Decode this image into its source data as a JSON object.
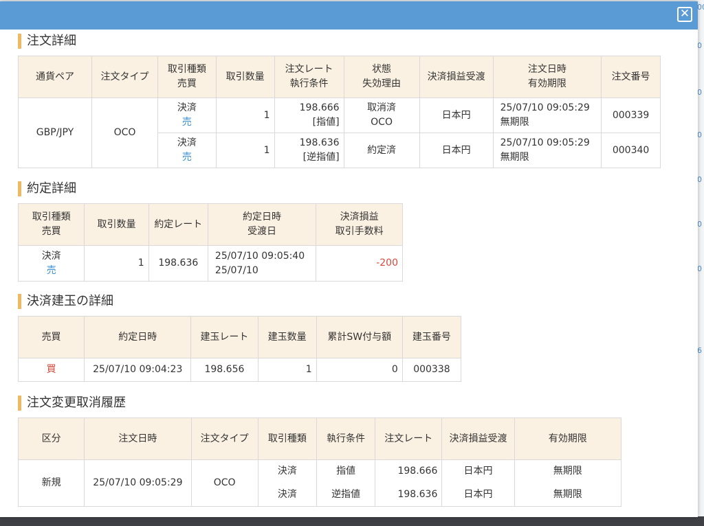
{
  "close_label": "✕",
  "background": {
    "side_values": [
      "00",
      "0",
      "0",
      "0",
      "0",
      "0",
      "0",
      "6"
    ]
  },
  "order_detail": {
    "title": "注文詳細",
    "headers": [
      [
        "通貨ペア"
      ],
      [
        "注文タイプ"
      ],
      [
        "取引種類",
        "売買"
      ],
      [
        "取引数量"
      ],
      [
        "注文レート",
        "執行条件"
      ],
      [
        "状態",
        "失効理由"
      ],
      [
        "決済損益受渡"
      ],
      [
        "注文日時",
        "有効期限"
      ],
      [
        "注文番号"
      ]
    ],
    "pair": "GBP/JPY",
    "order_type": "OCO",
    "rows": [
      {
        "trade_kind": "決済",
        "side": "売",
        "qty": "1",
        "rate": "198.666",
        "condition": "[指値]",
        "status": "取消済",
        "reason": "OCO",
        "settlement": "日本円",
        "datetime": "25/07/10 09:05:29",
        "expiry": "無期限",
        "number": "000339"
      },
      {
        "trade_kind": "決済",
        "side": "売",
        "qty": "1",
        "rate": "198.636",
        "condition": "[逆指値]",
        "status": "約定済",
        "reason": "",
        "settlement": "日本円",
        "datetime": "25/07/10 09:05:29",
        "expiry": "無期限",
        "number": "000340"
      }
    ]
  },
  "execution_detail": {
    "title": "約定詳細",
    "headers": [
      [
        "取引種類",
        "売買"
      ],
      [
        "取引数量"
      ],
      [
        "約定レート"
      ],
      [
        "約定日時",
        "受渡日"
      ],
      [
        "決済損益",
        "取引手数料"
      ]
    ],
    "row": {
      "trade_kind": "決済",
      "side": "売",
      "qty": "1",
      "rate": "198.636",
      "datetime": "25/07/10 09:05:40",
      "delivery": "25/07/10",
      "pnl": "-200"
    }
  },
  "position_detail": {
    "title": "決済建玉の詳細",
    "headers": [
      "売買",
      "約定日時",
      "建玉レート",
      "建玉数量",
      "累計SW付与額",
      "建玉番号"
    ],
    "row": {
      "side": "買",
      "datetime": "25/07/10 09:04:23",
      "rate": "198.656",
      "qty": "1",
      "swap": "0",
      "number": "000338"
    }
  },
  "history": {
    "title": "注文変更取消履歴",
    "headers": [
      "区分",
      "注文日時",
      "注文タイプ",
      "取引種類",
      "執行条件",
      "注文レート",
      "決済損益受渡",
      "有効期限"
    ],
    "category": "新規",
    "datetime": "25/07/10 09:05:29",
    "order_type": "OCO",
    "rows": [
      {
        "trade_kind": "決済",
        "condition": "指値",
        "rate": "198.666",
        "settlement": "日本円",
        "expiry": "無期限"
      },
      {
        "trade_kind": "決済",
        "condition": "逆指値",
        "rate": "198.636",
        "settlement": "日本円",
        "expiry": "無期限"
      }
    ]
  }
}
